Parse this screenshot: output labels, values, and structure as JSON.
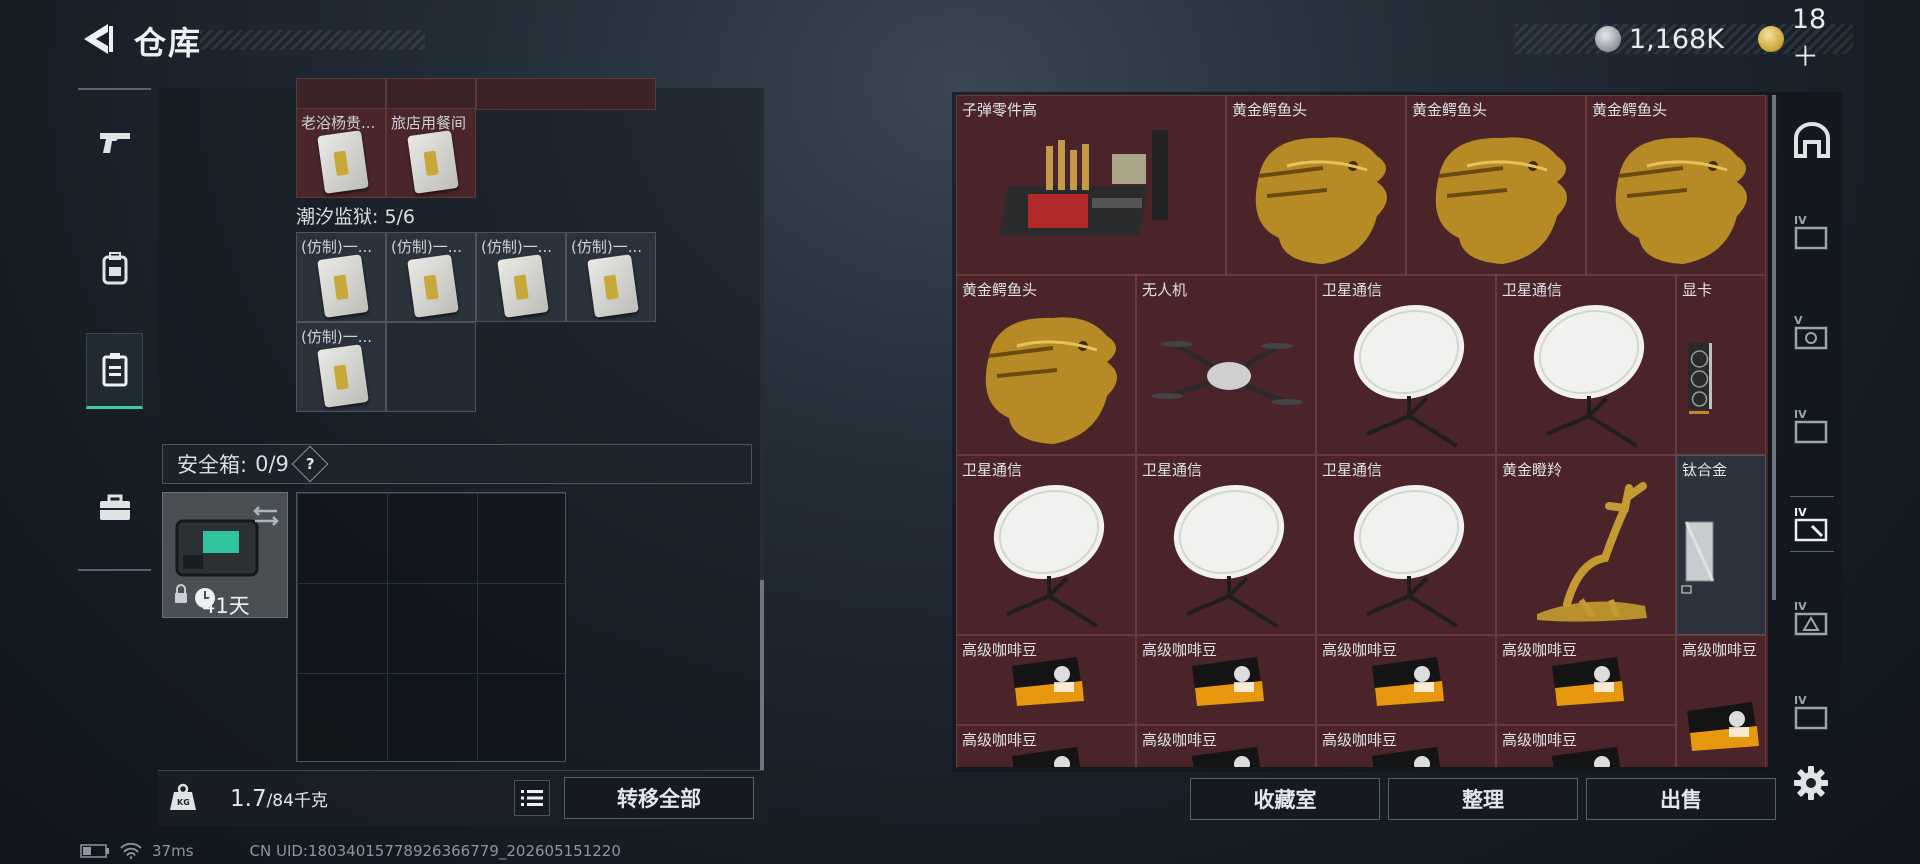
{
  "header": {
    "title": "仓库",
    "currency_amount": "1,168K",
    "token_amount": "18＋"
  },
  "stash": {
    "top_cells": [
      {
        "label": "老浴杨贵..."
      },
      {
        "label": "旅店用餐间"
      }
    ],
    "section_label": "潮汐监狱: 5/6",
    "section_cells": [
      {
        "label": "(仿制)一..."
      },
      {
        "label": "(仿制)一..."
      },
      {
        "label": "(仿制)一..."
      },
      {
        "label": "(仿制)一..."
      },
      {
        "label": "(仿制)一..."
      }
    ],
    "safe_title": "安全箱:",
    "safe_count": "0/9",
    "safe_help": "?",
    "safe_days": "41天",
    "weight_value": "1.7",
    "weight_limit": "/84千克",
    "transfer_all_label": "转移全部"
  },
  "inventory": {
    "items": [
      {
        "label": "子弹零件高",
        "icon": "ammo-parts-crate-icon"
      },
      {
        "label": "黄金鳄鱼头",
        "icon": "golden-crocodile-head-icon"
      },
      {
        "label": "黄金鳄鱼头",
        "icon": "golden-crocodile-head-icon"
      },
      {
        "label": "黄金鳄鱼头",
        "icon": "golden-crocodile-head-icon"
      },
      {
        "label": "黄金鳄鱼头",
        "icon": "golden-crocodile-head-icon"
      },
      {
        "label": "无人机",
        "icon": "drone-icon"
      },
      {
        "label": "卫星通信",
        "icon": "satellite-dish-icon"
      },
      {
        "label": "卫星通信",
        "icon": "satellite-dish-icon"
      },
      {
        "label": "显卡",
        "icon": "graphics-card-icon"
      },
      {
        "label": "卫星通信",
        "icon": "satellite-dish-icon"
      },
      {
        "label": "卫星通信",
        "icon": "satellite-dish-icon"
      },
      {
        "label": "卫星通信",
        "icon": "satellite-dish-icon"
      },
      {
        "label": "黄金瞪羚",
        "icon": "golden-gazelle-icon"
      },
      {
        "label": "钛合金",
        "icon": "titanium-alloy-icon"
      },
      {
        "label": "高级咖啡豆",
        "icon": "coffee-beans-icon"
      },
      {
        "label": "高级咖啡豆",
        "icon": "coffee-beans-icon"
      },
      {
        "label": "高级咖啡豆",
        "icon": "coffee-beans-icon"
      },
      {
        "label": "高级咖啡豆",
        "icon": "coffee-beans-icon"
      },
      {
        "label": "高级咖啡豆",
        "icon": "coffee-beans-icon"
      },
      {
        "label": "高级咖啡豆",
        "icon": "coffee-beans-icon"
      },
      {
        "label": "高级咖啡豆",
        "icon": "coffee-beans-icon"
      },
      {
        "label": "高级咖啡豆",
        "icon": "coffee-beans-icon"
      },
      {
        "label": "高级咖啡豆",
        "icon": "coffee-beans-icon"
      }
    ],
    "collection_label": "收藏室",
    "sort_label": "整理",
    "sell_label": "出售"
  },
  "right_nav": [
    "IV",
    "V",
    "IV",
    "IV",
    "IV",
    "IV"
  ],
  "status": {
    "ping": "37ms",
    "uid": "CN UID:18034015778926366779_202605151220"
  },
  "colors": {
    "accent": "#3ecda3",
    "item_bg": "#4a2429",
    "gold": "#c9a232"
  }
}
